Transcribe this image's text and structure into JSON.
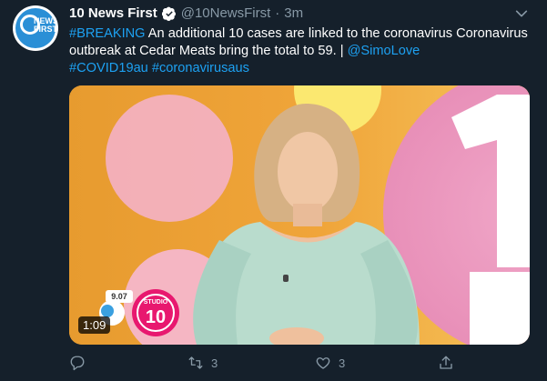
{
  "account": {
    "avatar_text": "NEWS FIRST",
    "avatar_number": "10",
    "display_name": "10 News First",
    "handle": "@10NewsFirst",
    "separator": "·",
    "timestamp": "3m"
  },
  "tweet": {
    "hashtag_breaking": "#BREAKING",
    "text_main": " An additional 10 cases are linked to the coronavirus Coronavirus outbreak at Cedar Meats bring the total to 59. | ",
    "mention": "@SimoLove",
    "hashtag_covid": "#COVID19au",
    "hashtag_corona": "#coronavirusaus"
  },
  "media": {
    "duration": "1:09",
    "logo_text_small": "STUDIO",
    "logo_number": "10",
    "weather_value": "9.07"
  },
  "actions": {
    "retweet_count": "3",
    "like_count": "3"
  },
  "colors": {
    "background": "#15202b",
    "accent": "#1da1f2",
    "muted": "#8899a6"
  }
}
